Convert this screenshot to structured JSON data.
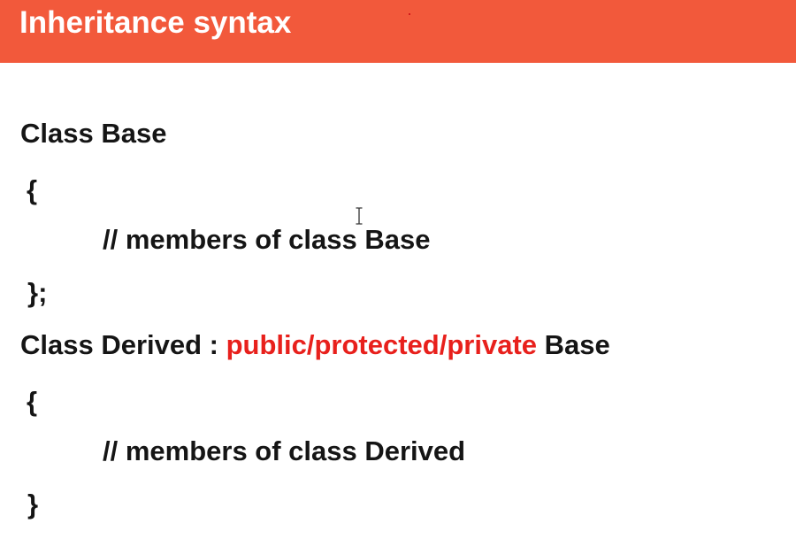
{
  "slide": {
    "title": "Inheritance syntax"
  },
  "code": {
    "base_decl": "Class Base",
    "base_open": "{",
    "base_comment": "// members of class Base",
    "base_close": "};",
    "derived_decl_prefix": "Class Derived : ",
    "derived_access": "public/protected/private",
    "derived_decl_suffix": " Base",
    "derived_open": "{",
    "derived_comment": "// members of class Derived",
    "derived_close": "}"
  },
  "colors": {
    "title_bar": "#f2593b",
    "title_text": "#ffffff",
    "code_text": "#151515",
    "access_specifier": "#e8201c"
  },
  "icons": {
    "cursor": "text-cursor-icon"
  }
}
